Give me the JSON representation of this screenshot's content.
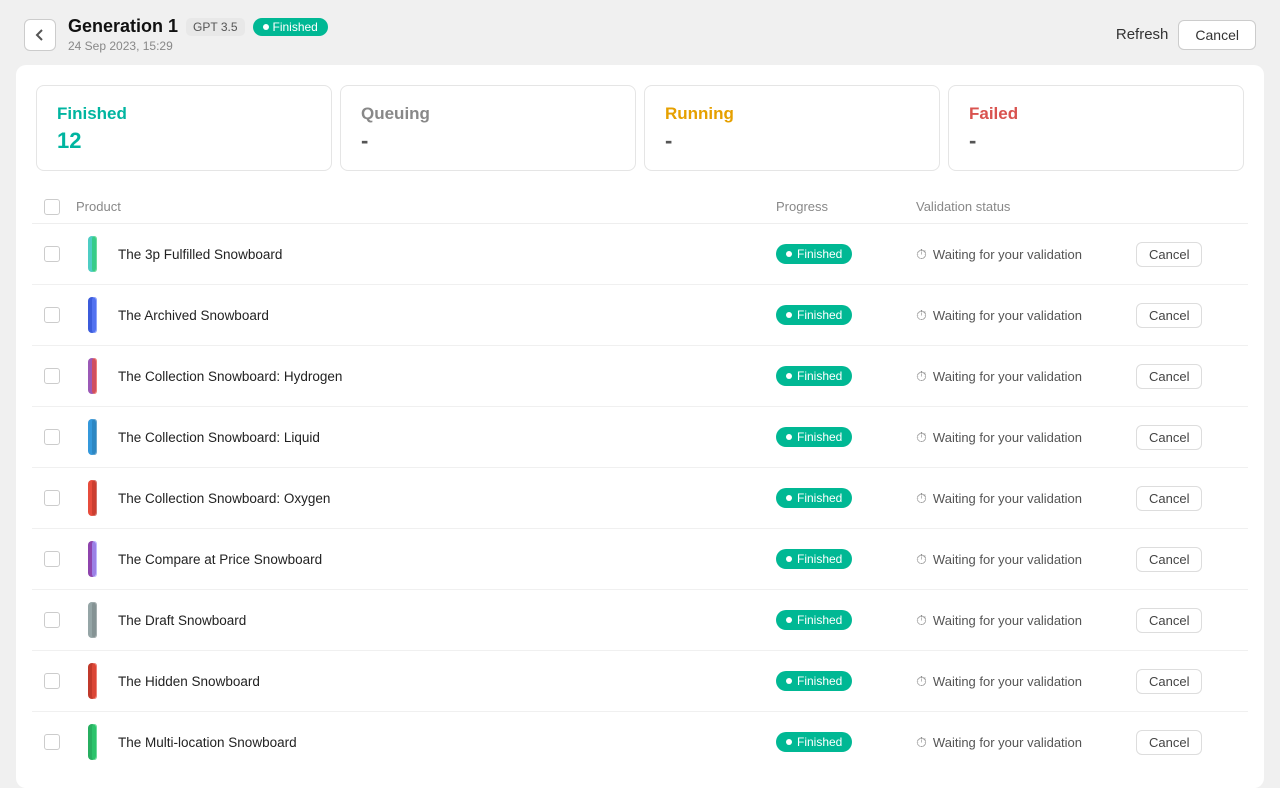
{
  "header": {
    "back_label": "←",
    "title": "Generation 1",
    "gpt_label": "GPT 3.5",
    "status_label": "Finished",
    "subtitle": "24 Sep 2023, 15:29",
    "refresh_label": "Refresh",
    "cancel_label": "Cancel"
  },
  "stats": [
    {
      "id": "finished",
      "label": "Finished",
      "value": "12",
      "type": "finished"
    },
    {
      "id": "queuing",
      "label": "Queuing",
      "value": "-",
      "type": "queuing"
    },
    {
      "id": "running",
      "label": "Running",
      "value": "-",
      "type": "running"
    },
    {
      "id": "failed",
      "label": "Failed",
      "value": "-",
      "type": "failed"
    }
  ],
  "table": {
    "columns": [
      "",
      "Product",
      "Progress",
      "Validation status",
      ""
    ],
    "rows": [
      {
        "name": "The 3p Fulfilled Snowboard",
        "progress": "Finished",
        "validation": "Waiting for your validation",
        "thumb_color": "#4ecdc4"
      },
      {
        "name": "The Archived Snowboard",
        "progress": "Finished",
        "validation": "Waiting for your validation",
        "thumb_color": "#5b6abf"
      },
      {
        "name": "The Collection Snowboard: Hydrogen",
        "progress": "Finished",
        "validation": "Waiting for your validation",
        "thumb_color": "#9b59b6"
      },
      {
        "name": "The Collection Snowboard: Liquid",
        "progress": "Finished",
        "validation": "Waiting for your validation",
        "thumb_color": "#3498db"
      },
      {
        "name": "The Collection Snowboard: Oxygen",
        "progress": "Finished",
        "validation": "Waiting for your validation",
        "thumb_color": "#e74c3c"
      },
      {
        "name": "The Compare at Price Snowboard",
        "progress": "Finished",
        "validation": "Waiting for your validation",
        "thumb_color": "#8e44ad"
      },
      {
        "name": "The Draft Snowboard",
        "progress": "Finished",
        "validation": "Waiting for your validation",
        "thumb_color": "#7f8c8d"
      },
      {
        "name": "The Hidden Snowboard",
        "progress": "Finished",
        "validation": "Waiting for your validation",
        "thumb_color": "#c0392b"
      },
      {
        "name": "The Multi-location Snowboard",
        "progress": "Finished",
        "validation": "Waiting for your validation",
        "thumb_color": "#27ae60"
      }
    ],
    "cancel_label": "Cancel"
  },
  "colors": {
    "finished_green": "#00b894",
    "accent_teal": "#00b5a0"
  }
}
